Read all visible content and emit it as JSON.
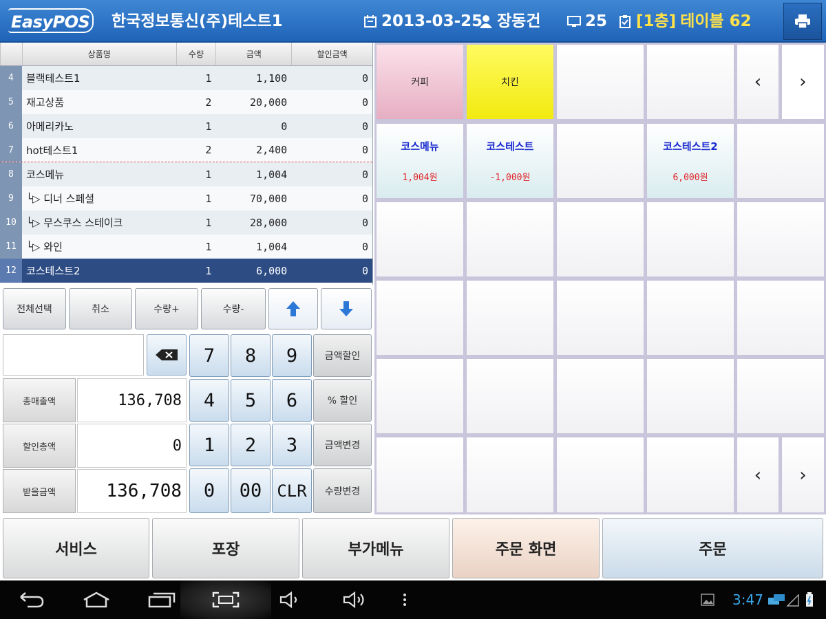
{
  "header": {
    "logo": "EasyPOS",
    "store_name": "한국정보통신(주)테스트1",
    "date": "2013-03-25",
    "user": "장동건",
    "count": "25",
    "floor": "[1층]",
    "table": "테이블 62"
  },
  "order_table": {
    "columns": [
      "상품명",
      "수량",
      "금액",
      "할인금액"
    ],
    "rows": [
      {
        "no": "4",
        "name": "블랙테스트1",
        "qty": "1",
        "amount": "1,100",
        "discount": "0"
      },
      {
        "no": "5",
        "name": "재고상품",
        "qty": "2",
        "amount": "20,000",
        "discount": "0"
      },
      {
        "no": "6",
        "name": "아메리카노",
        "qty": "1",
        "amount": "0",
        "discount": "0"
      },
      {
        "no": "7",
        "name": "hot테스트1",
        "qty": "2",
        "amount": "2,400",
        "discount": "0"
      },
      {
        "no": "8",
        "name": "코스메뉴",
        "qty": "1",
        "amount": "1,004",
        "discount": "0"
      },
      {
        "no": "9",
        "name": "└▷ 디너 스페셜",
        "qty": "1",
        "amount": "70,000",
        "discount": "0"
      },
      {
        "no": "10",
        "name": "└▷ 무스쿠스 스테이크",
        "qty": "1",
        "amount": "28,000",
        "discount": "0"
      },
      {
        "no": "11",
        "name": "└▷ 와인",
        "qty": "1",
        "amount": "1,004",
        "discount": "0"
      },
      {
        "no": "12",
        "name": "코스테스트2",
        "qty": "1",
        "amount": "6,000",
        "discount": "0"
      }
    ]
  },
  "controls": {
    "select_all": "전체선택",
    "cancel": "취소",
    "qty_plus": "수량+",
    "qty_minus": "수량-"
  },
  "totals": {
    "total_sales_label": "총매출액",
    "total_sales": "136,708",
    "total_discount_label": "할인총액",
    "total_discount": "0",
    "received_label": "받을금액",
    "received": "136,708"
  },
  "keypad": {
    "k7": "7",
    "k8": "8",
    "k9": "9",
    "k4": "4",
    "k5": "5",
    "k6": "6",
    "k1": "1",
    "k2": "2",
    "k3": "3",
    "k0": "0",
    "k00": "00",
    "kclr": "CLR",
    "amount_discount": "금액할인",
    "percent_discount": "% 할인",
    "amount_change": "금액변경",
    "qty_change": "수량변경"
  },
  "menu": {
    "categories": [
      {
        "label": "커피",
        "color": "#e6aec2"
      },
      {
        "label": "치킨",
        "color": "#f2ea10"
      }
    ],
    "items": [
      {
        "name": "코스메뉴",
        "price": "1,004원"
      },
      {
        "name": "코스테스트",
        "price": "-1,000원"
      },
      {
        "name": "코스테스트2",
        "price": "6,000원"
      }
    ],
    "prev": "‹",
    "next": "›"
  },
  "actions": {
    "service": "서비스",
    "takeout": "포장",
    "extra_menu": "부가메뉴",
    "order_screen": "주문 화면",
    "order": "주문"
  },
  "statusbar": {
    "clock": "3:47"
  },
  "colors": {
    "header": "#2b72c6",
    "selected_row": "#2d4c84",
    "price_red": "#e0242a",
    "item_blue": "#1a2ad0",
    "clock_blue": "#3aa8ea"
  }
}
